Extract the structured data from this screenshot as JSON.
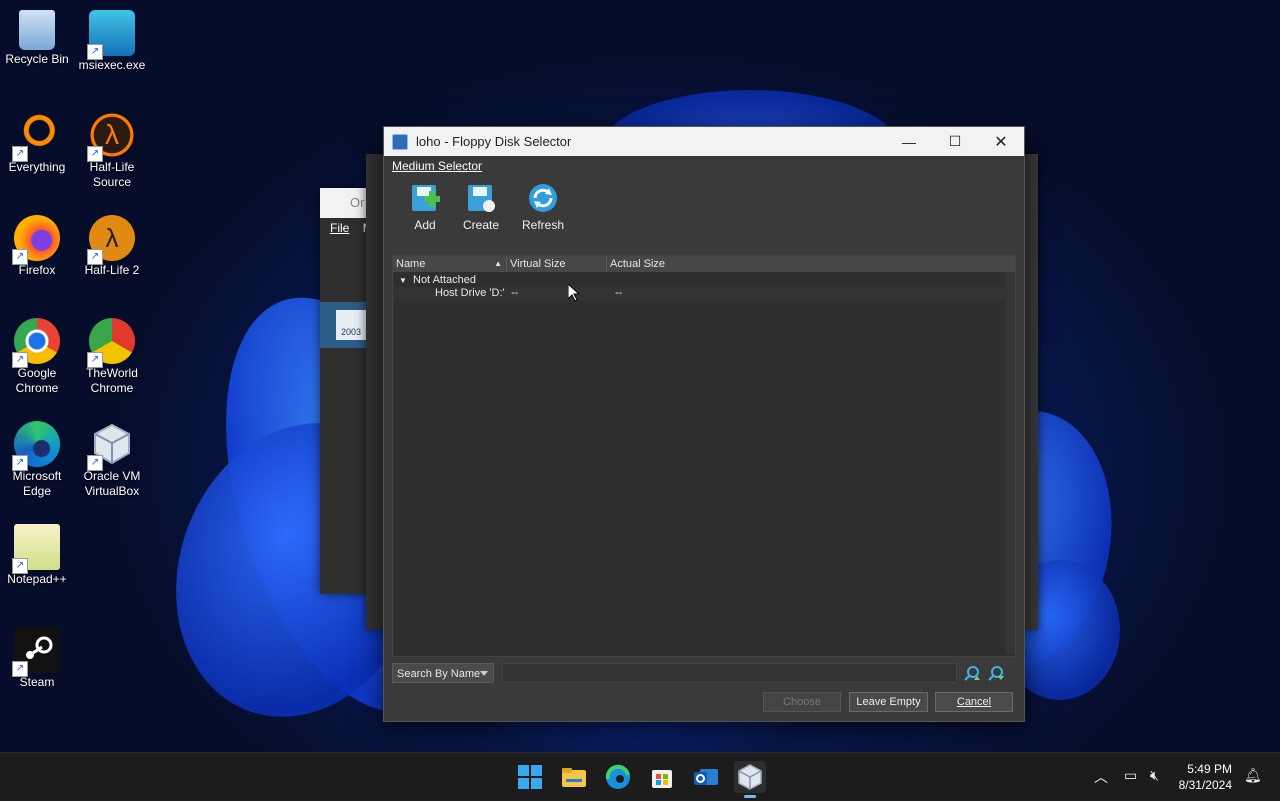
{
  "desktop": {
    "icons": [
      {
        "label": "Recycle Bin"
      },
      {
        "label": "msiexec.exe"
      },
      {
        "label": "Everything"
      },
      {
        "label": "Half-Life Source"
      },
      {
        "label": "Firefox"
      },
      {
        "label": "Half-Life 2"
      },
      {
        "label": "Google Chrome"
      },
      {
        "label": "TheWorld Chrome"
      },
      {
        "label": "Microsoft Edge"
      },
      {
        "label": "Oracle VM VirtualBox"
      },
      {
        "label": "Notepad++"
      },
      {
        "label": "Steam"
      }
    ]
  },
  "background_window": {
    "title_fragment": "Or",
    "menu": [
      "File",
      "M"
    ],
    "badge": "2003"
  },
  "dialog": {
    "title": "loho - Floppy Disk Selector",
    "menu_label": "Medium Selector",
    "toolbar": [
      {
        "label": "Add",
        "icon": "add-disk-icon"
      },
      {
        "label": "Create",
        "icon": "create-disk-icon"
      },
      {
        "label": "Refresh",
        "icon": "refresh-icon"
      }
    ],
    "columns": [
      "Name",
      "Virtual Size",
      "Actual Size"
    ],
    "tree": {
      "group": "Not Attached",
      "rows": [
        {
          "name": "Host Drive 'D:'",
          "virtual_size": "--",
          "actual_size": "--"
        }
      ]
    },
    "search": {
      "mode": "Search By Name",
      "value": ""
    },
    "buttons": {
      "choose": "Choose",
      "leave_empty": "Leave Empty",
      "cancel": "Cancel"
    }
  },
  "taskbar": {
    "apps": [
      "start-icon",
      "file-explorer-icon",
      "edge-icon",
      "store-icon",
      "outlook-icon",
      "virtualbox-icon"
    ],
    "clock": {
      "time": "5:49 PM",
      "date": "8/31/2024"
    }
  },
  "colors": {
    "accent": "#1a5bd8",
    "dialog_bg": "#3a3a3a",
    "taskbar_bg": "#1c1c1c"
  }
}
